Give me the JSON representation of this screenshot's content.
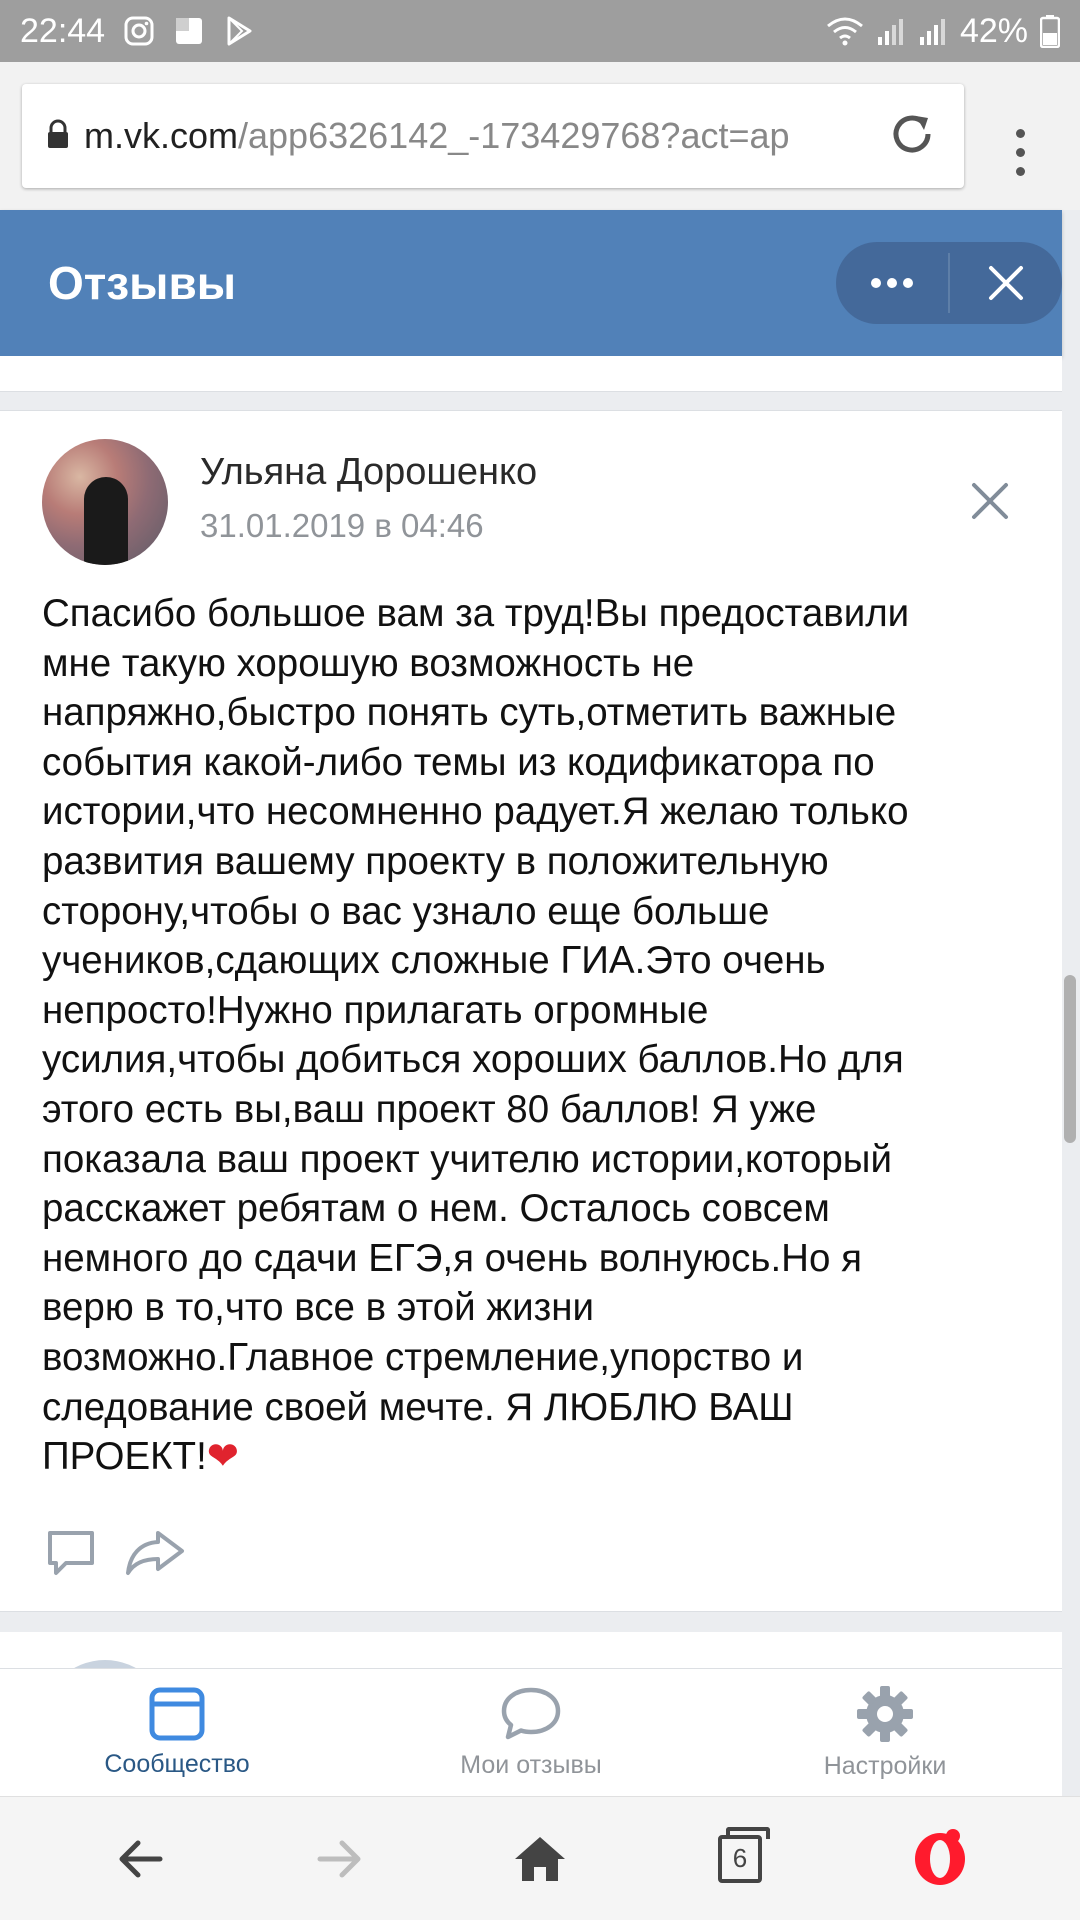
{
  "status_bar": {
    "time": "22:44",
    "battery": "42%"
  },
  "browser": {
    "url_domain": "m.vk.com",
    "url_path": "/app6326142_-173429768?act=ap"
  },
  "app_header": {
    "title": "Отзывы"
  },
  "review": {
    "author": "Ульяна Дорошенко",
    "date": "31.01.2019 в 04:46",
    "lines": [
      "Спасибо большое вам за труд!Вы предоставили",
      "мне такую хорошую возможность не",
      "напряжно,быстро понять суть,отметить важные",
      "события какой-либо темы из кодификатора по",
      "истории,что несомненно радует.Я желаю только",
      "развития вашему проекту в положительную",
      "сторону,чтобы о вас узнало еще больше",
      "учеников,сдающих сложные ГИА.Это очень",
      "непросто!Нужно прилагать огромные",
      "усилия,чтобы добиться хороших баллов.Но для",
      "этого есть вы,ваш проект 80 баллов! Я уже",
      "показала ваш проект учителю истории,который",
      "расскажет ребятам о нем. Осталось совсем",
      "немного до сдачи ЕГЭ,я очень волнуюсь.Но я",
      "верю в то,что все в этой жизни",
      "возможно.Главное стремление,упорство и",
      "следование своей мечте. Я ЛЮБЛЮ ВАШ",
      "ПРОЕКТ!"
    ],
    "heart": "❤"
  },
  "tabbar": {
    "items": [
      {
        "label": "Сообщество",
        "icon": "community-icon",
        "active": true
      },
      {
        "label": "Мои отзывы",
        "icon": "chat-bubble-icon",
        "active": false
      },
      {
        "label": "Настройки",
        "icon": "gear-icon",
        "active": false
      }
    ]
  },
  "browser_nav": {
    "tabs_count": "6"
  },
  "colors": {
    "vk_header": "#5181b8",
    "vk_active_tab": "#2a5885",
    "status_bar": "#9e9e9e"
  }
}
